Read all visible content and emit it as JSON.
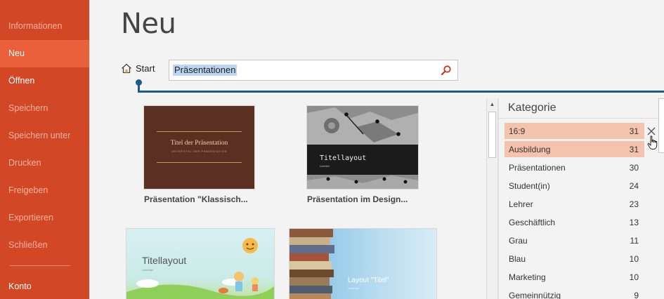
{
  "sidebar": {
    "items": [
      {
        "label": "Informationen",
        "state": "disabled"
      },
      {
        "label": "Neu",
        "state": "active"
      },
      {
        "label": "Öffnen",
        "state": "enabled"
      },
      {
        "label": "Speichern",
        "state": "disabled"
      },
      {
        "label": "Speichern unter",
        "state": "disabled"
      },
      {
        "label": "Drucken",
        "state": "disabled"
      },
      {
        "label": "Freigeben",
        "state": "disabled"
      },
      {
        "label": "Exportieren",
        "state": "disabled"
      },
      {
        "label": "Schließen",
        "state": "disabled"
      }
    ],
    "account_label": "Konto"
  },
  "header": {
    "title": "Neu"
  },
  "search": {
    "home_label": "Start",
    "value": "Präsentationen",
    "icon": "search-icon"
  },
  "templates": [
    {
      "caption": "Präsentation \"Klassisch...",
      "thumb_title": "Titel der Präsentation",
      "thumb_subtitle": "UNTERTITEL DER PRÄSENTATION"
    },
    {
      "caption": "Präsentation im Design...",
      "thumb_title": "Titellayout",
      "thumb_subtitle": "Untertitel"
    },
    {
      "caption": "",
      "thumb_title": "Titellayout",
      "thumb_subtitle": "Untertitel"
    },
    {
      "caption": "",
      "thumb_title": "Layout \"Titel\"",
      "thumb_subtitle": "Untertitel"
    }
  ],
  "category_panel": {
    "title": "Kategorie",
    "items": [
      {
        "label": "16:9",
        "count": "31",
        "selected": true
      },
      {
        "label": "Ausbildung",
        "count": "31",
        "selected": true
      },
      {
        "label": "Präsentationen",
        "count": "30",
        "selected": false
      },
      {
        "label": "Student(in)",
        "count": "24",
        "selected": false
      },
      {
        "label": "Lehrer",
        "count": "23",
        "selected": false
      },
      {
        "label": "Geschäftlich",
        "count": "13",
        "selected": false
      },
      {
        "label": "Grau",
        "count": "11",
        "selected": false
      },
      {
        "label": "Blau",
        "count": "10",
        "selected": false
      },
      {
        "label": "Marketing",
        "count": "10",
        "selected": false
      },
      {
        "label": "Gemeinnützig",
        "count": "9",
        "selected": false
      }
    ]
  },
  "colors": {
    "sidebar_bg": "#d24726",
    "sidebar_active": "#e9603a",
    "selected_category": "#f5c3ad",
    "callout": "#1e5b8c"
  }
}
